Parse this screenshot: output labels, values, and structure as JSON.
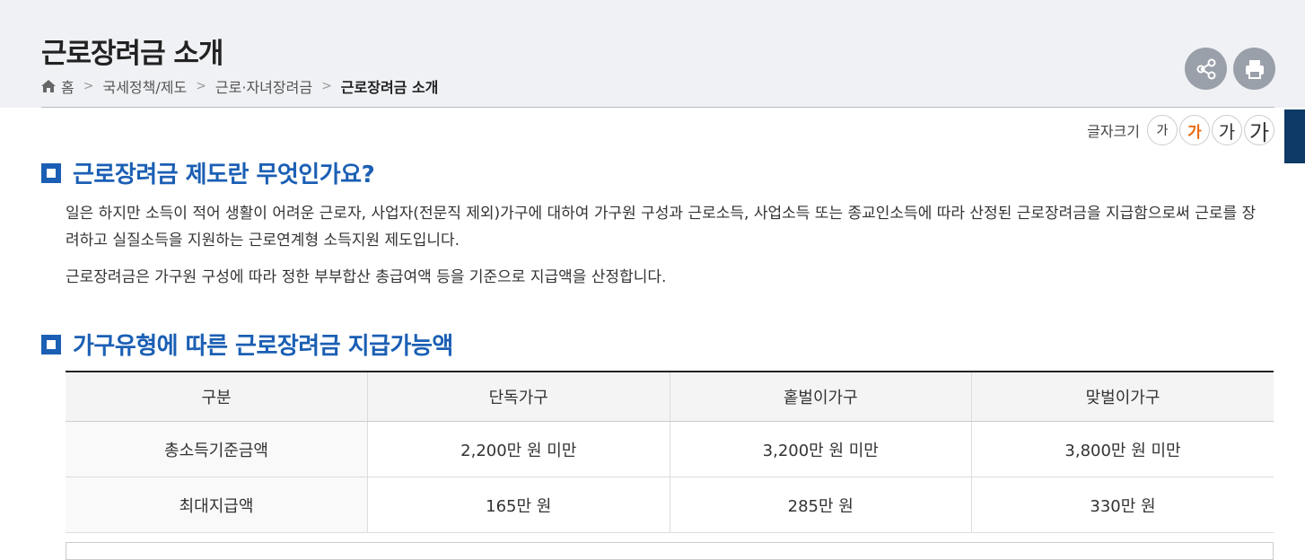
{
  "page": {
    "title": "근로장려금 소개"
  },
  "breadcrumb": {
    "home": "홈",
    "items": [
      "국세정책/제도",
      "근로·자녀장려금"
    ],
    "current": "근로장려금 소개"
  },
  "toolbar": {
    "share_icon": "share-icon",
    "print_icon": "print-icon"
  },
  "font_size": {
    "label": "글자크기",
    "options": [
      "가",
      "가",
      "가",
      "가"
    ],
    "selected_index": 1
  },
  "sections": [
    {
      "title": "근로장려금 제도란 무엇인가요?",
      "paragraphs": [
        "일은 하지만 소득이 적어 생활이 어려운 근로자, 사업자(전문직 제외)가구에 대하여 가구원 구성과 근로소득, 사업소득 또는 종교인소득에 따라 산정된 근로장려금을 지급함으로써 근로를 장려하고 실질소득을 지원하는 근로연계형 소득지원 제도입니다.",
        "근로장려금은 가구원 구성에 따라 정한 부부합산 총급여액 등을 기준으로 지급액을 산정합니다."
      ]
    },
    {
      "title": "가구유형에 따른 근로장려금 지급가능액"
    }
  ],
  "table": {
    "headers": [
      "구분",
      "단독가구",
      "홑벌이가구",
      "맞벌이가구"
    ],
    "rows": [
      [
        "총소득기준금액",
        "2,200만 원 미만",
        "3,200만 원 미만",
        "3,800만 원 미만"
      ],
      [
        "최대지급액",
        "165만 원",
        "285만 원",
        "330만 원"
      ]
    ]
  },
  "colors": {
    "accent": "#1b5fb4",
    "selected_font": "#e86a12",
    "side_tab": "#0d3a66"
  }
}
